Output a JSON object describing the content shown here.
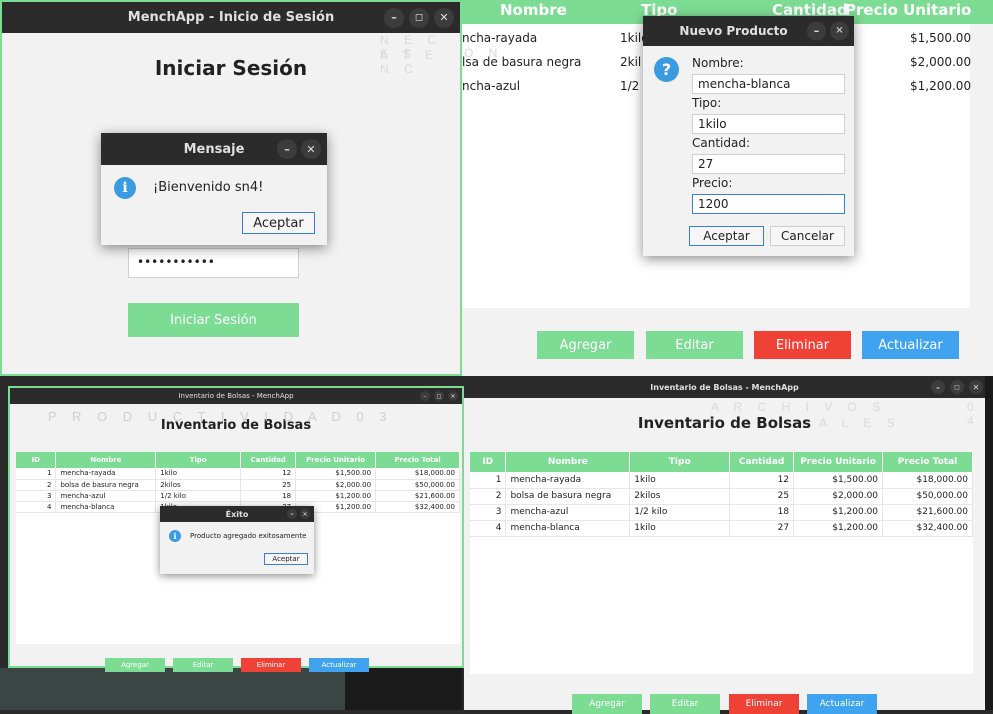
{
  "login": {
    "title": "MenchApp - Inicio de Sesión",
    "heading": "Iniciar Sesión",
    "password_mask": "•••••••••••",
    "submit_label": "Iniciar Sesión",
    "dialog": {
      "title": "Mensaje",
      "message": "¡Bienvenido sn4!",
      "ok": "Aceptar"
    }
  },
  "watermarks": {
    "w1a": "N E C E S",
    "w1b": "A T E N C",
    "w1c": "Ó N",
    "w3": "P R O D U C T I V I D A D   0 3",
    "w4a": "A R C H I V O S",
    "w4b": "A L E S",
    "w4c": "0 4"
  },
  "columns": [
    "ID",
    "Nombre",
    "Tipo",
    "Cantidad",
    "Precio Unitario",
    "Precio Total"
  ],
  "rows": [
    {
      "id": "1",
      "nombre": "mencha-rayada",
      "tipo": "1kilo",
      "cantidad": "12",
      "unitario": "$1,500.00",
      "total": "$18,000.00"
    },
    {
      "id": "2",
      "nombre": "bolsa de basura negra",
      "tipo": "2kilos",
      "cantidad": "25",
      "unitario": "$2,000.00",
      "total": "$50,000.00"
    },
    {
      "id": "3",
      "nombre": "mencha-azul",
      "tipo": "1/2 kilo",
      "cantidad": "18",
      "unitario": "$1,200.00",
      "total": "$21,600.00"
    },
    {
      "id": "4",
      "nombre": "mencha-blanca",
      "tipo": "1kilo",
      "cantidad": "27",
      "unitario": "$1,200.00",
      "total": "$32,400.00"
    }
  ],
  "quad2": {
    "cropped_rows": [
      {
        "nombre": "ncha-rayada",
        "tipo": "1kilo",
        "unitario": "$1,500.00"
      },
      {
        "nombre": "lsa de basura negra",
        "tipo": "2kil",
        "unitario": "$2,000.00"
      },
      {
        "nombre": "ncha-azul",
        "tipo": "1/2",
        "unitario": "$1,200.00"
      }
    ],
    "stray_digit": "1"
  },
  "new_product": {
    "title": "Nuevo Producto",
    "nombre_label": "Nombre:",
    "nombre_value": "mencha-blanca",
    "tipo_label": "Tipo:",
    "tipo_value": "1kilo",
    "cantidad_label": "Cantidad:",
    "cantidad_value": "27",
    "precio_label": "Precio:",
    "precio_value": "1200",
    "ok": "Aceptar",
    "cancel": "Cancelar"
  },
  "inventory": {
    "title": "Inventario de Bolsas - MenchApp",
    "heading": "Inventario de Bolsas",
    "success_dialog": {
      "title": "Éxito",
      "message": "Producto agregado exitosamente",
      "ok": "Aceptar"
    }
  },
  "actions": {
    "add": "Agregar",
    "edit": "Editar",
    "delete": "Eliminar",
    "refresh": "Actualizar"
  }
}
